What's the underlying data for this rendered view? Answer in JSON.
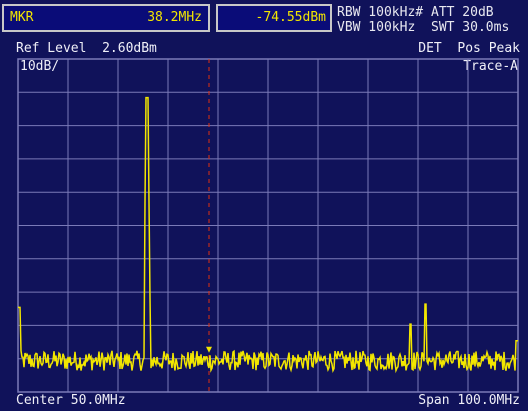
{
  "marker": {
    "label": "MKR",
    "frequency": "38.2MHz",
    "level": "-74.55dBm"
  },
  "settings": {
    "rbw": "RBW 100kHz#",
    "att": "ATT 20dB",
    "vbw": "VBW 100kHz",
    "swt": "SWT 30.0ms"
  },
  "display": {
    "ref_level": "Ref Level  2.60dBm",
    "detector": "DET  Pos Peak",
    "scale": "10dB/",
    "trace": "Trace-A",
    "center": "Center 50.0MHz",
    "span": "Span 100.0MHz"
  },
  "colors": {
    "trace": "#f2e600",
    "grid": "#7a7ab8",
    "marker_line": "#e03010",
    "background": "#10125a"
  },
  "chart_data": {
    "type": "line",
    "x_unit": "MHz",
    "y_unit": "dBm",
    "xlim": [
      0,
      100
    ],
    "ylim": [
      -97.4,
      2.6
    ],
    "grid": true,
    "noise_floor_dbm": -88,
    "peaks": [
      {
        "freq": 0.2,
        "level": -72
      },
      {
        "freq": 25.8,
        "level": -9
      },
      {
        "freq": 78.5,
        "level": -77
      },
      {
        "freq": 81.5,
        "level": -71
      },
      {
        "freq": 99.8,
        "level": -82
      }
    ],
    "marker_freq": 38.2,
    "marker_level": -74.55
  }
}
